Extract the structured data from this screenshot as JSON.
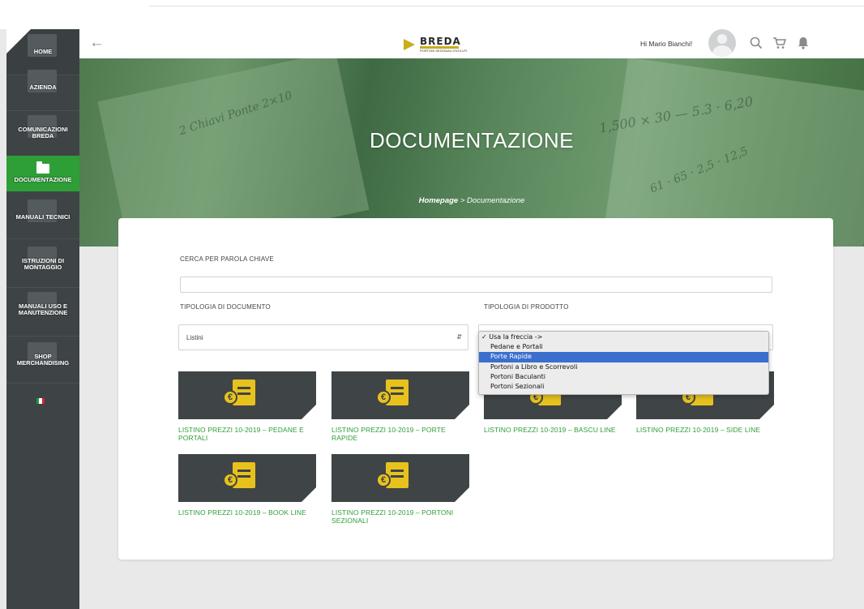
{
  "sidebar": {
    "items": [
      {
        "label": "HOME"
      },
      {
        "label": "AZIENDA"
      },
      {
        "label": "COMUNICAZIONI BREDA"
      },
      {
        "label": "DOCUMENTAZIONE"
      },
      {
        "label": "MANUALI TECNICI"
      },
      {
        "label": "ISTRUZIONI DI MONTAGGIO"
      },
      {
        "label": "MANUALI USO E MANUTENZIONE"
      },
      {
        "label": "SHOP MERCHANDISING"
      }
    ],
    "language_flag": "italian-flag-icon"
  },
  "header": {
    "logo_text": "BREDA",
    "logo_subtitle": "PORTONI SEZIONALI EVOLUTI",
    "greeting": "Hi Mario Bianchi!",
    "icons": [
      "back-arrow-icon",
      "avatar",
      "search-icon",
      "cart-icon",
      "bell-icon"
    ]
  },
  "hero": {
    "title": "DOCUMENTAZIONE",
    "breadcrumb_home": "Homepage",
    "breadcrumb_sep": " > ",
    "breadcrumb_current": "Documentazione"
  },
  "search": {
    "keyword_label": "CERCA PER PAROLA CHIAVE",
    "keyword_value": ""
  },
  "filters": {
    "doc_type_label": "TIPOLOGIA DI DOCUMENTO",
    "doc_type_value": "Listini",
    "product_type_label": "TIPOLOGIA DI PRODOTTO",
    "product_options": [
      {
        "label": "Usa la freccia ->",
        "checked": true,
        "highlighted": false
      },
      {
        "label": "Pedane e Portali",
        "checked": false,
        "highlighted": false
      },
      {
        "label": "Porte Rapide",
        "checked": false,
        "highlighted": true
      },
      {
        "label": "Portoni a Libro e Scorrevoli",
        "checked": false,
        "highlighted": false
      },
      {
        "label": "Portoni Baculanti",
        "checked": false,
        "highlighted": false
      },
      {
        "label": "Portoni Sezionali",
        "checked": false,
        "highlighted": false
      }
    ]
  },
  "documents": [
    {
      "title": "LISTINO PREZZI 10-2019 – PEDANE E PORTALI",
      "icon": "price-list-icon"
    },
    {
      "title": "LISTINO PREZZI 10-2019 – PORTE RAPIDE",
      "icon": "price-list-icon"
    },
    {
      "title": "LISTINO PREZZI 10-2019 – BASCU LINE",
      "icon": "price-list-icon"
    },
    {
      "title": "LISTINO PREZZI 10-2019 – SIDE LINE",
      "icon": "price-list-icon"
    },
    {
      "title": "LISTINO PREZZI 10-2019 – BOOK LINE",
      "icon": "price-list-icon"
    },
    {
      "title": "LISTINO PREZZI 10-2019 – PORTONI SEZIONALI",
      "icon": "price-list-icon"
    }
  ],
  "colors": {
    "accent_green": "#2e9f36",
    "sidebar_bg": "#3e4446",
    "icon_yellow": "#e8c21c",
    "tile_bg": "#3f4446",
    "dropdown_highlight": "#3b6fce"
  }
}
